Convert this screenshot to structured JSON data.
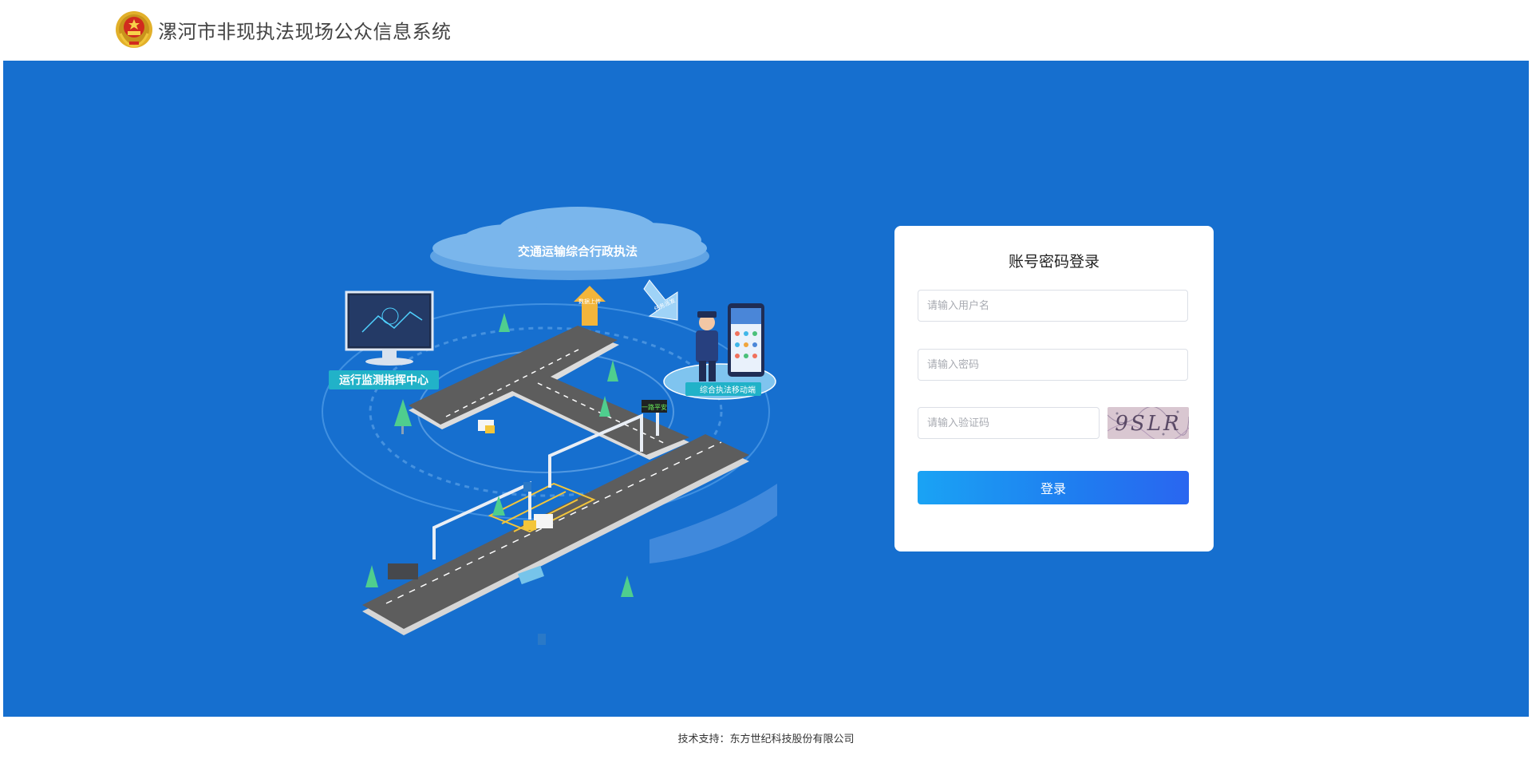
{
  "header": {
    "title": "漯河市非现执法现场公众信息系统"
  },
  "illustration": {
    "cloud_label": "交通运输综合行政执法",
    "monitor_label": "运行监测指挥中心",
    "mobile_label": "综合执法移动端",
    "upload_label": "数据上传",
    "dispatch_label": "任务派发",
    "sign_text": "一路平安"
  },
  "login": {
    "title": "账号密码登录",
    "username_placeholder": "请输入用户名",
    "password_placeholder": "请输入密码",
    "captcha_placeholder": "请输入验证码",
    "captcha_text": "9SLR",
    "submit_label": "登录"
  },
  "footer": {
    "text": "技术支持：东方世纪科技股份有限公司"
  },
  "colors": {
    "hero_bg": "#166fcf",
    "button_start": "#1aa3f4",
    "button_end": "#2a66f0"
  }
}
